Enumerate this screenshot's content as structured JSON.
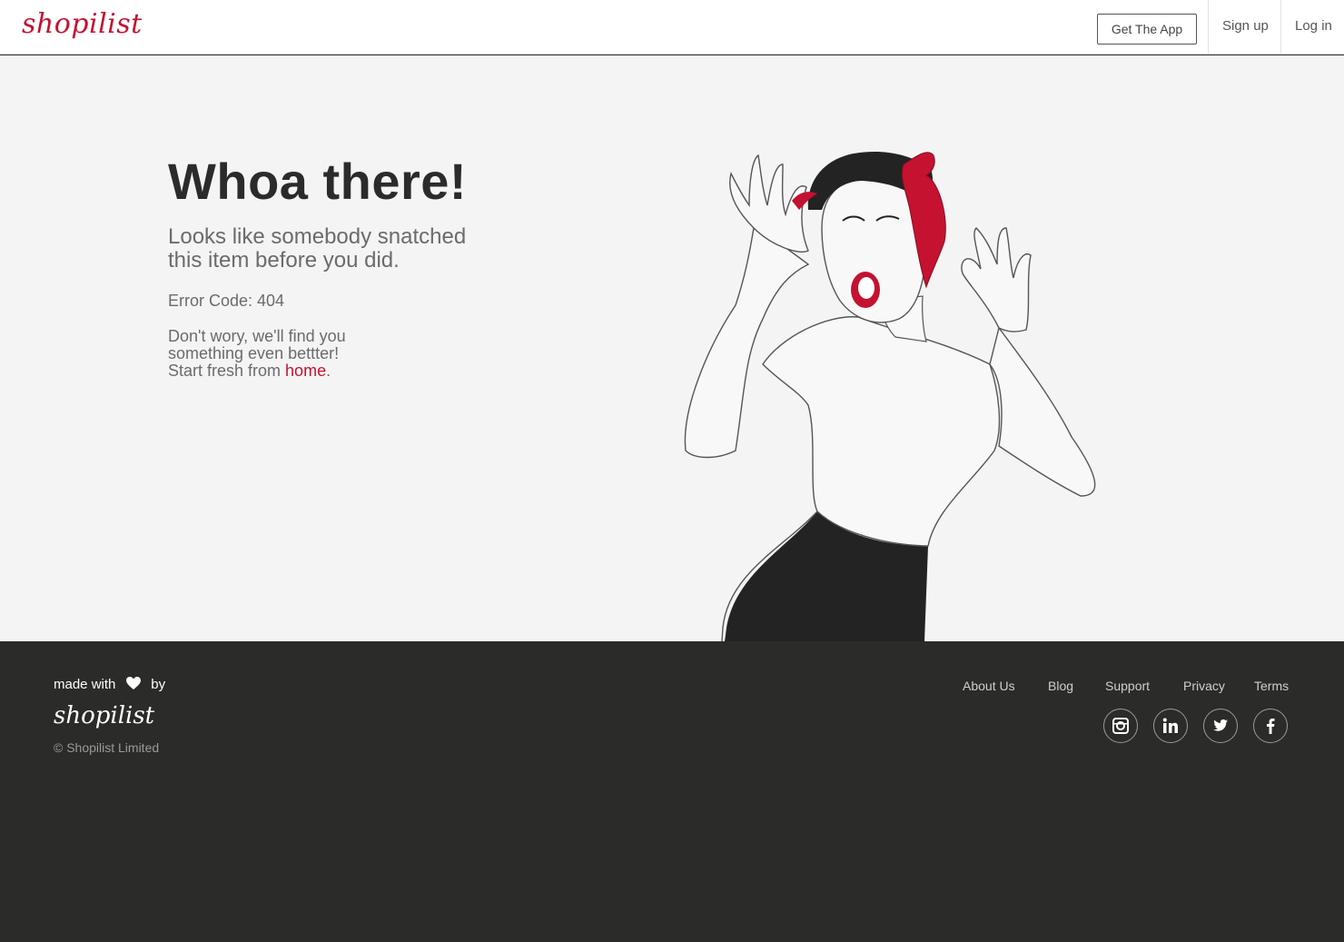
{
  "header": {
    "logo": "shopilist",
    "get_app_label": "Get The App",
    "signup_label": "Sign up",
    "login_label": "Log in"
  },
  "main": {
    "title": "Whoa there!",
    "subtitle": "Looks like somebody snatched this item before you did.",
    "error_code": "Error Code: 404",
    "line1": "Don't wory, we'll find you",
    "line2": "something even bettter!",
    "line3_prefix": "Start fresh from ",
    "home_link": "home",
    "line3_suffix": "."
  },
  "footer": {
    "made_with": "made with",
    "by": "by",
    "logo": "shopilist",
    "copyright": "© Shopilist Limited",
    "links": [
      "About Us",
      "Blog",
      "Support",
      "Privacy",
      "Terms"
    ],
    "social_icons": [
      "instagram-icon",
      "linkedin-icon",
      "twitter-icon",
      "facebook-icon"
    ]
  },
  "colors": {
    "brand": "#c41230",
    "footer_bg": "#2b2b2a",
    "page_bg": "#f4f4f4"
  }
}
